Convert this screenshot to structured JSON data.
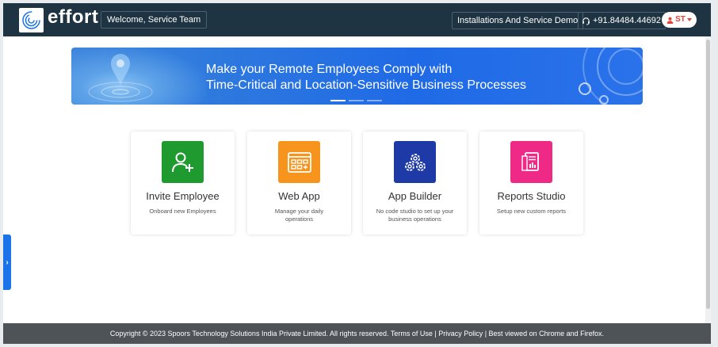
{
  "header": {
    "logo_text": "effort",
    "welcome": "Welcome, Service Team",
    "company": "Installations And Service Demo",
    "phone": "+91.84484.44692",
    "user_initials": "ST"
  },
  "banner": {
    "line1": "Make your Remote Employees Comply with",
    "line2": "Time-Critical and Location-Sensitive Business Processes"
  },
  "cards": [
    {
      "title": "Invite Employee",
      "desc1": "Onboard new Employees",
      "desc2": "",
      "color": "#1e9a2f",
      "icon": "add-user-icon"
    },
    {
      "title": "Web App",
      "desc1": "Manage your daily",
      "desc2": "operations",
      "color": "#f7941d",
      "icon": "web-app-icon"
    },
    {
      "title": "App Builder",
      "desc1": "No code studio to set up your",
      "desc2": "business operations",
      "color": "#1d3aa6",
      "icon": "gears-icon"
    },
    {
      "title": "Reports Studio",
      "desc1": "Setup new custom reports",
      "desc2": "",
      "color": "#ee2a86",
      "icon": "report-icon"
    }
  ],
  "footer": {
    "text": "Copyright © 2023 Spoors Technology Solutions India Private Limited. All rights reserved. Terms of Use | Privacy Policy | Best viewed on Chrome and Firefox."
  },
  "side_tab": {
    "glyph": "›"
  },
  "colors": {
    "header_bg": "#1f3442",
    "footer_bg": "#4d5357",
    "accent": "#1a73e8"
  }
}
